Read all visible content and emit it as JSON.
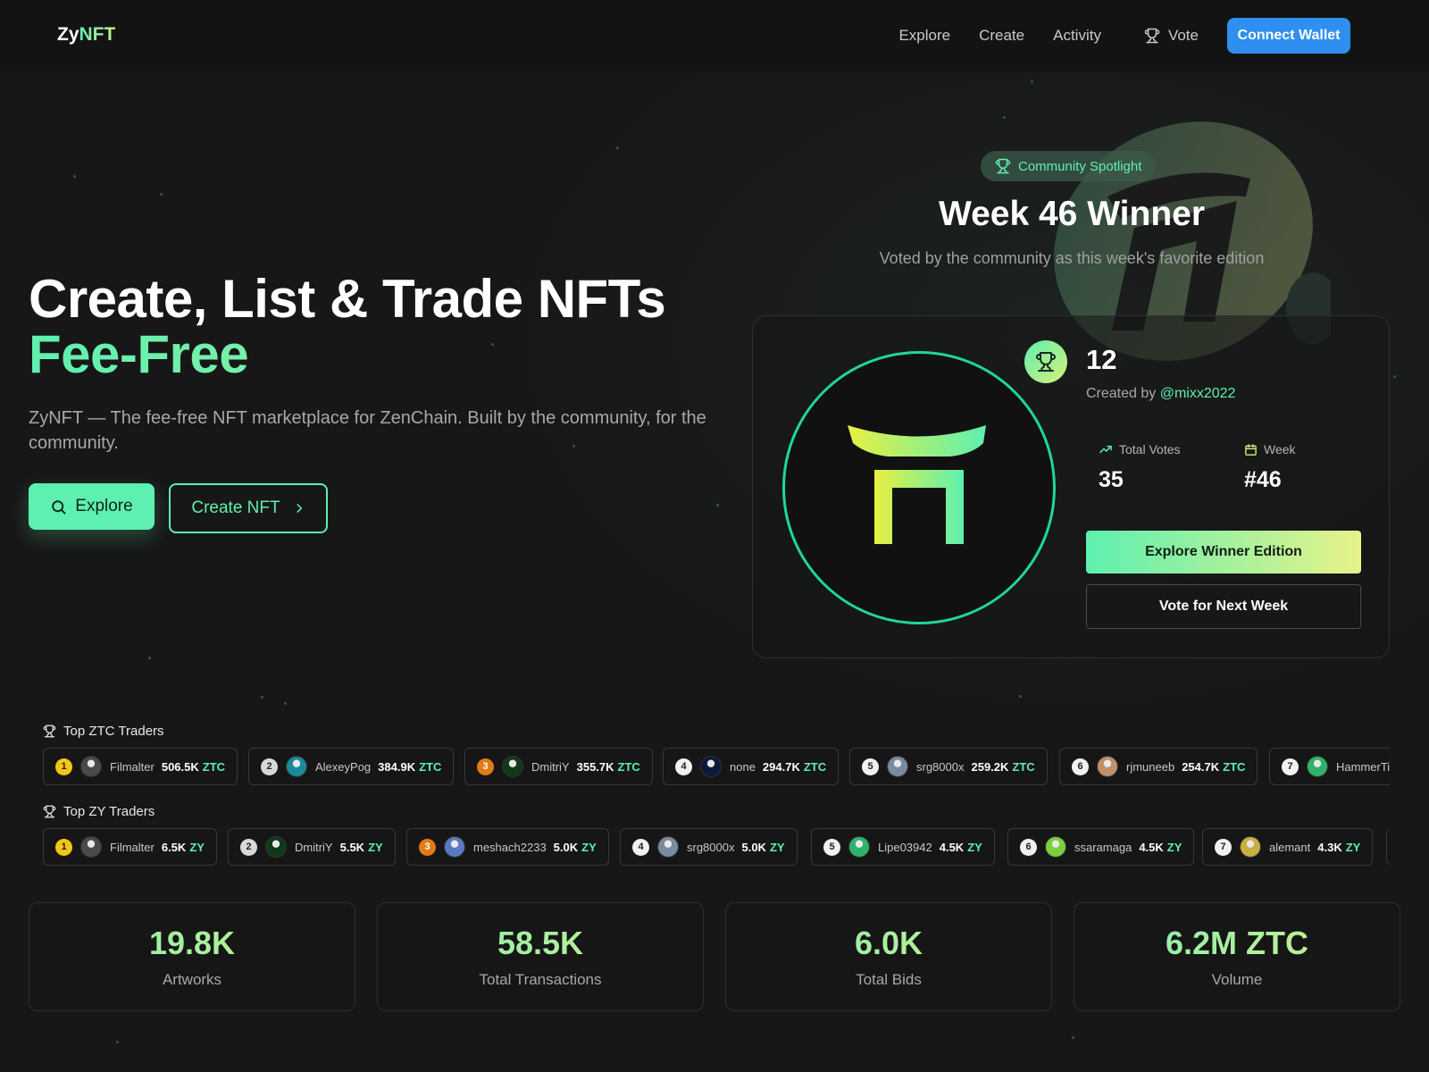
{
  "header": {
    "logo_part1": "Zy",
    "logo_part2": "NFT",
    "nav": [
      "Explore",
      "Create",
      "Activity"
    ],
    "vote_label": "Vote",
    "connect_label": "Connect Wallet"
  },
  "hero": {
    "title_line1": "Create, List & Trade NFTs",
    "title_line2": "Fee-Free",
    "subtitle": "ZyNFT — The fee-free NFT marketplace for ZenChain. Built by the community, for the community.",
    "explore_label": "Explore",
    "create_label": "Create NFT"
  },
  "spotlight": {
    "badge": "Community Spotlight",
    "title": "Week 46 Winner",
    "subtitle": "Voted by the community as this week's favorite edition",
    "edition": "12",
    "created_by": "Created by",
    "creator": "@mixx2022",
    "total_votes_label": "Total Votes",
    "total_votes": "35",
    "week_label": "Week",
    "week": "#46",
    "explore_winner_label": "Explore Winner Edition",
    "vote_next_label": "Vote for Next Week"
  },
  "top_ztc": {
    "title": "Top ZTC Traders",
    "unit": "ZTC",
    "traders": [
      {
        "rank": "1",
        "name": "Filmalter",
        "amount": "506.5K",
        "avatar_color": "#4a4a4a"
      },
      {
        "rank": "2",
        "name": "AlexeyPog",
        "amount": "384.9K",
        "avatar_color": "#1a8a9a"
      },
      {
        "rank": "3",
        "name": "DmitriY",
        "amount": "355.7K",
        "avatar_color": "#0e3a1a"
      },
      {
        "rank": "4",
        "name": "none",
        "amount": "294.7K",
        "avatar_color": "#0a1a3a"
      },
      {
        "rank": "5",
        "name": "srg8000x",
        "amount": "259.2K",
        "avatar_color": "#7a8aa0"
      },
      {
        "rank": "6",
        "name": "rjmuneeb",
        "amount": "254.7K",
        "avatar_color": "#c0906a"
      },
      {
        "rank": "7",
        "name": "HammerTi",
        "amount": "",
        "avatar_color": "#2fb36a"
      }
    ]
  },
  "top_zy": {
    "title": "Top ZY Traders",
    "unit": "ZY",
    "traders": [
      {
        "rank": "1",
        "name": "Filmalter",
        "amount": "6.5K",
        "avatar_color": "#4a4a4a"
      },
      {
        "rank": "2",
        "name": "DmitriY",
        "amount": "5.5K",
        "avatar_color": "#0e3a1a"
      },
      {
        "rank": "3",
        "name": "meshach2233",
        "amount": "5.0K",
        "avatar_color": "#5a7ac0"
      },
      {
        "rank": "4",
        "name": "srg8000x",
        "amount": "5.0K",
        "avatar_color": "#7a8aa0"
      },
      {
        "rank": "5",
        "name": "Lipe03942",
        "amount": "4.5K",
        "avatar_color": "#2fb36a"
      },
      {
        "rank": "6",
        "name": "ssaramaga",
        "amount": "4.5K",
        "avatar_color": "#7ad03a"
      },
      {
        "rank": "7",
        "name": "alemant",
        "amount": "4.3K",
        "avatar_color": "#c8b040"
      }
    ]
  },
  "stats": [
    {
      "value": "19.8K",
      "label": "Artworks"
    },
    {
      "value": "58.5K",
      "label": "Total Transactions"
    },
    {
      "value": "6.0K",
      "label": "Total Bids"
    },
    {
      "value": "6.2M ZTC",
      "label": "Volume"
    }
  ],
  "colors": {
    "accent": "#5ef0b0",
    "accent2": "#d8f07a",
    "connect": "#2f8ff0",
    "background": "#171717"
  }
}
